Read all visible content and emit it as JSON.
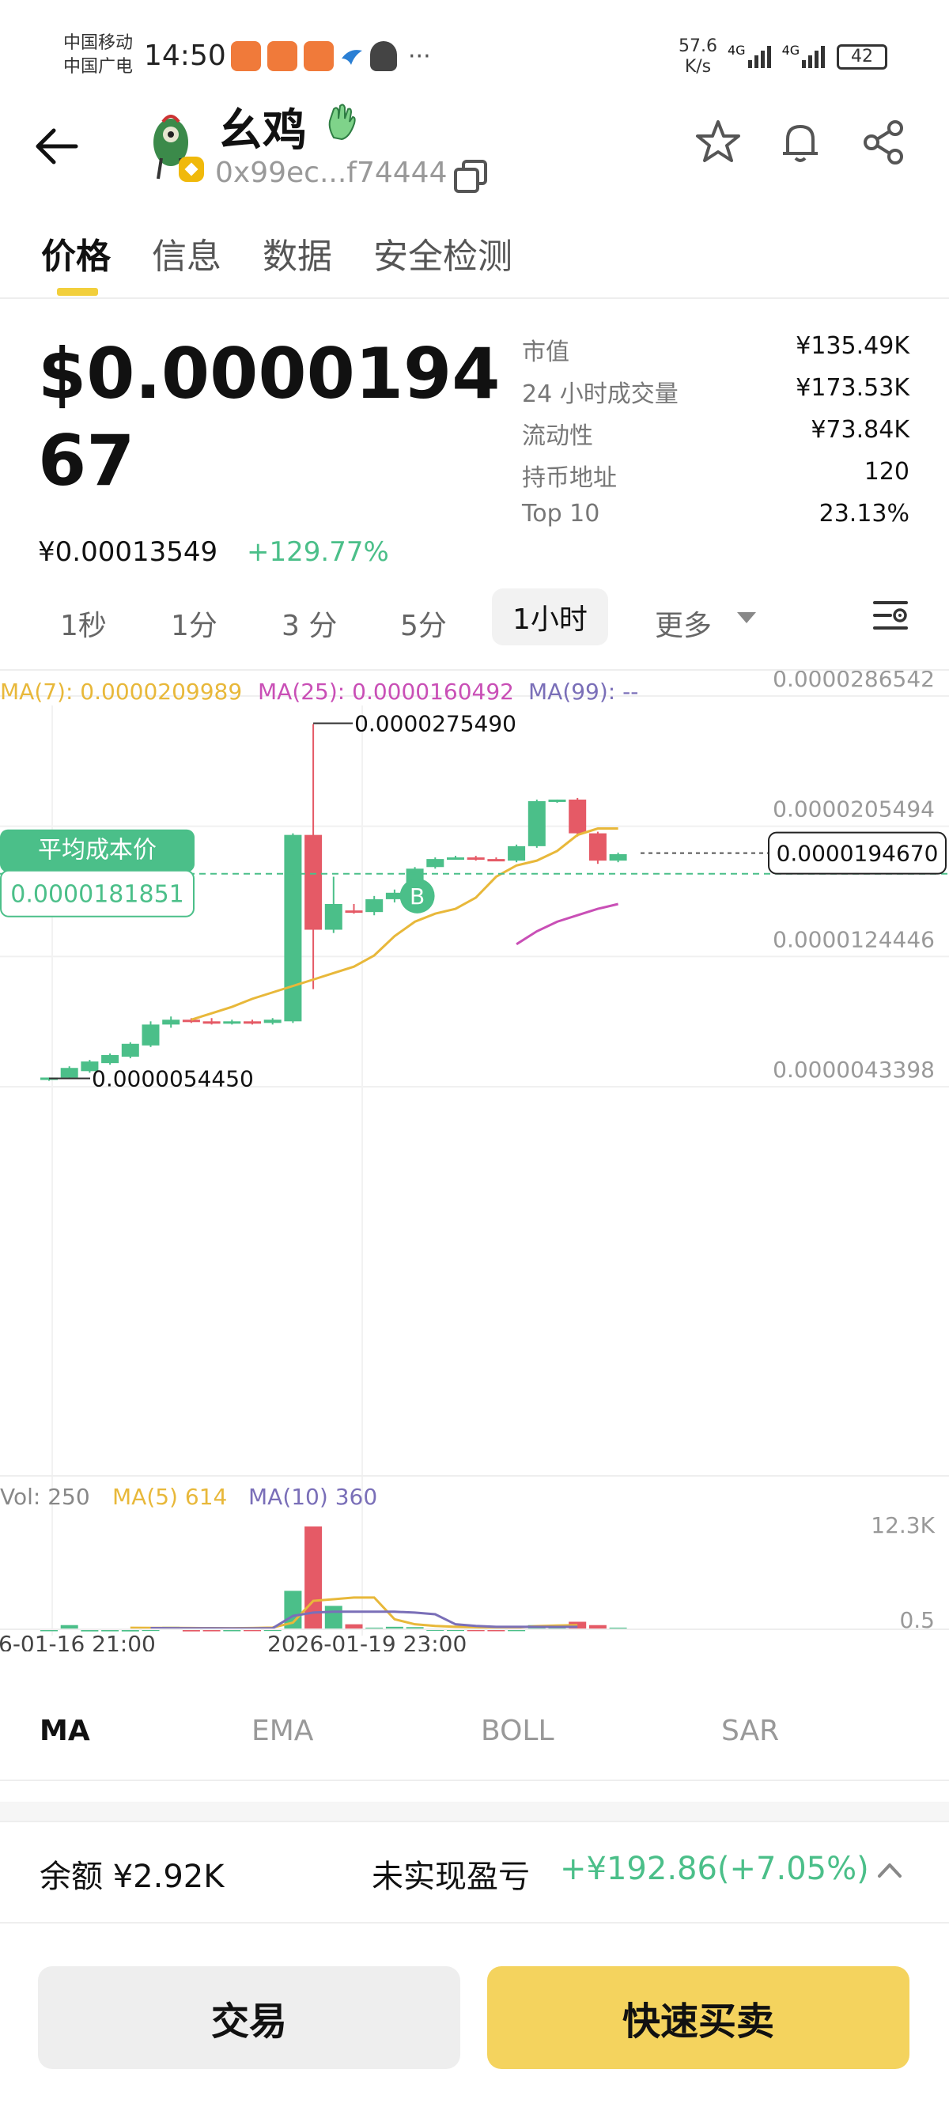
{
  "status_bar": {
    "carrier_1": "中国移动",
    "carrier_2": "中国广电",
    "time": "14:50",
    "net_speed_value": "57.6",
    "net_speed_unit": "K/s",
    "signal_1": "4G",
    "signal_2": "4G",
    "battery": "42"
  },
  "header": {
    "token_name": "幺鸡",
    "contract_address": "0x99ec...f74444"
  },
  "tabs": [
    "价格",
    "信息",
    "数据",
    "安全检测"
  ],
  "active_tab": 0,
  "price": {
    "usd": "$0.000019467",
    "cny": "¥0.00013549",
    "change": "+129.77%"
  },
  "stats": [
    {
      "label": "市值",
      "value": "¥135.49K"
    },
    {
      "label": "24 小时成交量",
      "value": "¥173.53K"
    },
    {
      "label": "流动性",
      "value": "¥73.84K"
    },
    {
      "label": "持币地址",
      "value": "120"
    },
    {
      "label": "Top 10",
      "value": "23.13%"
    }
  ],
  "intervals": [
    "1秒",
    "1分",
    "3 分",
    "5分",
    "1小时",
    "更多"
  ],
  "active_interval": 4,
  "chart_data": {
    "type": "candlestick",
    "ma_legend": {
      "ma7": "MA(7): 0.0000209989",
      "ma25": "MA(25): 0.0000160492",
      "ma99": "MA(99): --"
    },
    "y_ticks": [
      "0.0000286542",
      "0.0000205494",
      "0.0000124446",
      "0.0000043398"
    ],
    "y_tick_values": [
      2.86542e-05,
      2.05494e-05,
      1.24446e-05,
      4.3398e-06
    ],
    "high_label": "0.0000275490",
    "low_label": "0.0000054450",
    "current_price_label": "0.0000194670",
    "avg_cost_title": "平均成本价",
    "avg_cost_value": "0.0000181851",
    "buy_marker": "B",
    "candles": [
      {
        "o": 5.4e-06,
        "h": 5.5e-06,
        "l": 5.3e-06,
        "c": 5.5e-06
      },
      {
        "o": 5.5e-06,
        "h": 6.2e-06,
        "l": 5.4e-06,
        "c": 6.1e-06
      },
      {
        "o": 5.9e-06,
        "h": 6.6e-06,
        "l": 5.8e-06,
        "c": 6.5e-06
      },
      {
        "o": 6.4e-06,
        "h": 7e-06,
        "l": 6.3e-06,
        "c": 6.9e-06
      },
      {
        "o": 6.8e-06,
        "h": 7.7e-06,
        "l": 6.7e-06,
        "c": 7.6e-06
      },
      {
        "o": 7.5e-06,
        "h": 9e-06,
        "l": 7.4e-06,
        "c": 8.8e-06
      },
      {
        "o": 8.8e-06,
        "h": 9.3e-06,
        "l": 8.6e-06,
        "c": 9.1e-06
      },
      {
        "o": 9.1e-06,
        "h": 9.2e-06,
        "l": 8.9e-06,
        "c": 9e-06
      },
      {
        "o": 9e-06,
        "h": 9.2e-06,
        "l": 8.8e-06,
        "c": 8.9e-06
      },
      {
        "o": 8.9e-06,
        "h": 9.1e-06,
        "l": 8.8e-06,
        "c": 9e-06
      },
      {
        "o": 9e-06,
        "h": 9.1e-06,
        "l": 8.8e-06,
        "c": 8.9e-06
      },
      {
        "o": 8.9e-06,
        "h": 9.2e-06,
        "l": 8.8e-06,
        "c": 9.1e-06
      },
      {
        "o": 9e-06,
        "h": 2.07e-05,
        "l": 8.9e-06,
        "c": 2.06e-05
      },
      {
        "o": 2.06e-05,
        "h": 2.75e-05,
        "l": 1.1e-05,
        "c": 1.47e-05
      },
      {
        "o": 1.47e-05,
        "h": 1.8e-05,
        "l": 1.45e-05,
        "c": 1.63e-05
      },
      {
        "o": 1.59e-05,
        "h": 1.63e-05,
        "l": 1.57e-05,
        "c": 1.58e-05
      },
      {
        "o": 1.58e-05,
        "h": 1.68e-05,
        "l": 1.56e-05,
        "c": 1.66e-05
      },
      {
        "o": 1.66e-05,
        "h": 1.72e-05,
        "l": 1.64e-05,
        "c": 1.7e-05
      },
      {
        "o": 1.7e-05,
        "h": 1.86e-05,
        "l": 1.68e-05,
        "c": 1.85e-05
      },
      {
        "o": 1.86e-05,
        "h": 1.92e-05,
        "l": 1.85e-05,
        "c": 1.91e-05
      },
      {
        "o": 1.92e-05,
        "h": 1.93e-05,
        "l": 1.91e-05,
        "c": 1.92e-05
      },
      {
        "o": 1.92e-05,
        "h": 1.93e-05,
        "l": 1.9e-05,
        "c": 1.91e-05
      },
      {
        "o": 1.91e-05,
        "h": 1.92e-05,
        "l": 1.9e-05,
        "c": 1.9e-05
      },
      {
        "o": 1.9e-05,
        "h": 2e-05,
        "l": 1.89e-05,
        "c": 1.99e-05
      },
      {
        "o": 1.99e-05,
        "h": 2.28e-05,
        "l": 1.98e-05,
        "c": 2.27e-05
      },
      {
        "o": 2.27e-05,
        "h": 2.28e-05,
        "l": 2.26e-05,
        "c": 2.28e-05
      },
      {
        "o": 2.28e-05,
        "h": 2.29e-05,
        "l": 2.05e-05,
        "c": 2.07e-05
      },
      {
        "o": 2.07e-05,
        "h": 2.08e-05,
        "l": 1.88e-05,
        "c": 1.9e-05
      },
      {
        "o": 1.9e-05,
        "h": 1.95e-05,
        "l": 1.89e-05,
        "c": 1.94e-05
      }
    ],
    "ma7_line": [
      9.1e-06,
      9.5e-06,
      9.9e-06,
      1.04e-05,
      1.08e-05,
      1.12e-05,
      1.16e-05,
      1.2e-05,
      1.24e-05,
      1.31e-05,
      1.43e-05,
      1.52e-05,
      1.57e-05,
      1.6e-05,
      1.67e-05,
      1.8e-05,
      1.87e-05,
      1.9e-05,
      1.96e-05,
      2.06e-05,
      2.1e-05,
      2.1e-05
    ],
    "ma25_line": [
      1.38e-05,
      1.46e-05,
      1.52e-05,
      1.56e-05,
      1.6e-05,
      1.63e-05
    ],
    "volume": {
      "legend_vol": "Vol: 250",
      "legend_ma5": "MA(5) 614",
      "legend_ma10": "MA(10) 360",
      "y_ticks": [
        "12.3K",
        "0.5"
      ],
      "y_max": 12300,
      "bars": [
        50,
        500,
        30,
        40,
        30,
        80,
        300,
        30,
        40,
        50,
        60,
        80,
        4600,
        12300,
        2800,
        600,
        200,
        300,
        260,
        100,
        80,
        60,
        50,
        60,
        500,
        300,
        900,
        500,
        200
      ],
      "ma5_line": [
        180,
        170,
        160,
        150,
        140,
        130,
        150,
        200,
        800,
        3400,
        3600,
        3800,
        3800,
        1200,
        600,
        400,
        300,
        250,
        200,
        200,
        380,
        450,
        500
      ],
      "ma10_line": [
        140,
        130,
        120,
        120,
        110,
        110,
        130,
        1600,
        2000,
        2100,
        2100,
        2100,
        2100,
        2000,
        1800,
        600,
        400,
        300,
        300,
        300,
        280,
        300
      ]
    },
    "x_labels": [
      "6-01-16 21:00",
      "2026-01-19 23:00"
    ]
  },
  "indicator_tabs": [
    "MA",
    "EMA",
    "BOLL",
    "SAR"
  ],
  "active_indicator": 0,
  "balance": {
    "label": "余额 ¥2.92K",
    "pnl_label": "未实现盈亏",
    "pnl_value": "+¥192.86(+7.05%)"
  },
  "buttons": {
    "trade": "交易",
    "quick_trade": "快速买卖"
  },
  "colors": {
    "up": "#4bbf89",
    "down": "#e55a66",
    "accent": "#f4d35e",
    "ma7": "#e8b83a",
    "ma25": "#c94fb6",
    "ma99": "#7a6fb8"
  }
}
